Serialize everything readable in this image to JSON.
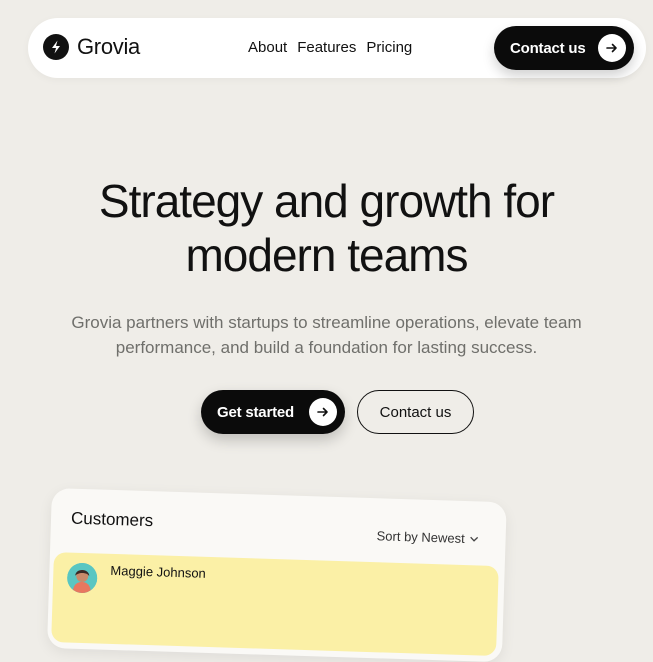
{
  "brand": {
    "name": "Grovia",
    "logo_icon": "bolt-icon"
  },
  "nav": {
    "links": [
      "About",
      "Features",
      "Pricing"
    ],
    "cta_label": "Contact us",
    "cta_icon": "arrow-right-icon"
  },
  "hero": {
    "title_line1": "Strategy and growth for",
    "title_line2": "modern teams",
    "subtitle": "Grovia partners with startups to streamline operations, elevate team performance, and build a foundation for lasting success.",
    "primary_label": "Get started",
    "primary_icon": "arrow-right-icon",
    "secondary_label": "Contact us"
  },
  "customers_card": {
    "title": "Customers",
    "sort_label": "Sort by Newest",
    "sort_icon": "chevron-down-icon",
    "rows": [
      {
        "name": "Maggie Johnson",
        "highlight_color": "#fbf0a6"
      }
    ]
  },
  "colors": {
    "background": "#efede8",
    "primary": "#0b0b0b",
    "muted_text": "#6f6f6b",
    "highlight": "#fbf0a6"
  }
}
